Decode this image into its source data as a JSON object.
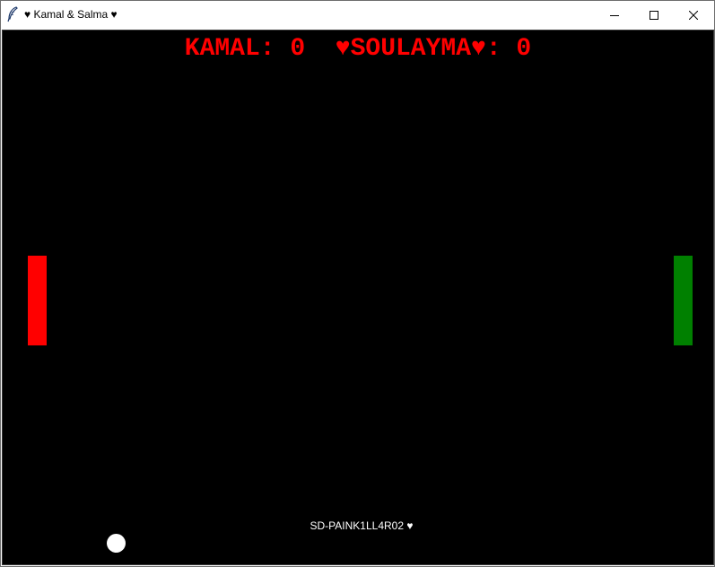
{
  "window": {
    "title": "♥ Kamal & Salma ♥",
    "icon": "feather-icon",
    "controls": [
      "minimize-icon",
      "maximize-icon",
      "close-icon"
    ]
  },
  "game": {
    "background_color": "#000000",
    "score_text": "KAMAL: 0  ♥SOULAYMA♥: 0",
    "score_color": "#ff0000",
    "player_left": {
      "name": "KAMAL",
      "score": 0,
      "paddle_color": "#ff0000"
    },
    "player_right": {
      "name": "♥SOULAYMA♥",
      "score": 0,
      "paddle_color": "#008000"
    },
    "ball_color": "#ffffff",
    "credit": "SD-PAINK1LL4R02 ♥",
    "credit_color": "#ffffff"
  }
}
